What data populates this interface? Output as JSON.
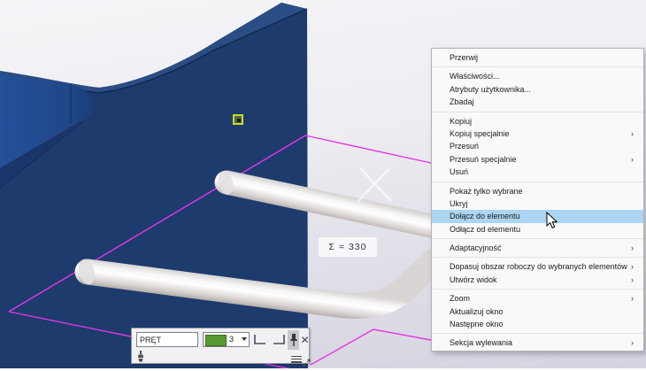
{
  "viewport": {
    "sum_annotation": "Σ = 330",
    "colors": {
      "plate_navy": "#1d3b6d",
      "plate_bevel": "#2a4d85",
      "slot_blue": "#25509a",
      "workplane_magenta": "#e536e5",
      "selection_handle_yellow": "#c9d92b",
      "menu_highlight_blue": "#abd5f2",
      "swatch_green": "#569a31",
      "rod_white": "#f7f6f6",
      "background_top": "#f5f5f8",
      "background_bottom": "#d4d3df"
    }
  },
  "mini_toolbar": {
    "name_field": {
      "value": "PRĘT"
    },
    "class_combo": {
      "value": "3"
    },
    "icons": {
      "corner_start": "corner-start-icon",
      "corner_end": "corner-end-icon",
      "pin": "pin-icon",
      "close": "✕",
      "brush": "brush-icon",
      "menu": "hamburger-icon",
      "resize": "resize-icon"
    }
  },
  "context_menu": {
    "submenu_arrow": "›",
    "items": [
      {
        "label": "Przerwij"
      },
      {
        "label": "Właściwości..."
      },
      {
        "label": "Atrybuty użytkownika..."
      },
      {
        "label": "Zbadaj"
      },
      {
        "label": "Kopiuj"
      },
      {
        "label": "Kopiuj specjalnie",
        "submenu": true
      },
      {
        "label": "Przesuń"
      },
      {
        "label": "Przesuń specjalnie",
        "submenu": true
      },
      {
        "label": "Usuń"
      },
      {
        "label": "Pokaż tylko wybrane"
      },
      {
        "label": "Ukryj"
      },
      {
        "label": "Dołącz do elementu",
        "highlighted": true
      },
      {
        "label": "Odłącz od elementu"
      },
      {
        "label": "Adaptacyjność",
        "submenu": true
      },
      {
        "label": "Dopasuj obszar roboczy do wybranych elementów",
        "submenu": true
      },
      {
        "label": "Utwórz widok",
        "submenu": true
      },
      {
        "label": "Zoom",
        "submenu": true
      },
      {
        "label": "Aktualizuj okno"
      },
      {
        "label": "Następne okno"
      },
      {
        "label": "Sekcja wylewania",
        "submenu": true
      }
    ]
  }
}
